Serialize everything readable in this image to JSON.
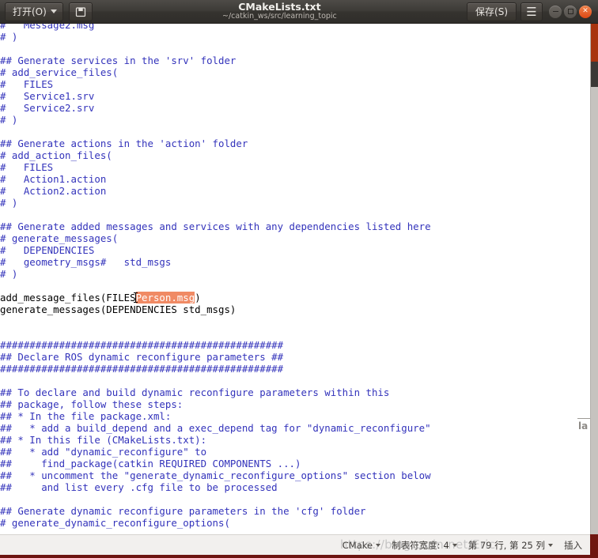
{
  "window": {
    "title": "CMakeLists.txt",
    "subtitle": "~/catkin_ws/src/learning_topic",
    "open_label": "打开(O)",
    "save_label": "保存(S)",
    "menu_icon": "hamburger-icon",
    "saveas_icon": "save-as-icon",
    "minimize_icon": "minimize-icon",
    "maximize_icon": "maximize-icon",
    "close_icon": "close-icon"
  },
  "editor": {
    "selection_text": "Person.msg",
    "selection_bg": "#f08a64",
    "comment_color": "#3333bb",
    "code_color": "#000000",
    "lines": [
      "#   Message2.msg",
      "# )",
      "",
      "## Generate services in the 'srv' folder",
      "# add_service_files(",
      "#   FILES",
      "#   Service1.srv",
      "#   Service2.srv",
      "# )",
      "",
      "## Generate actions in the 'action' folder",
      "# add_action_files(",
      "#   FILES",
      "#   Action1.action",
      "#   Action2.action",
      "# )",
      "",
      "## Generate added messages and services with any dependencies listed here",
      "# generate_messages(",
      "#   DEPENDENCIES",
      "#   geometry_msgs#   std_msgs",
      "# )",
      "",
      "__CODE_SELECTION_LINE__",
      "generate_messages(DEPENDENCIES std_msgs)",
      "",
      "",
      "################################################",
      "## Declare ROS dynamic reconfigure parameters ##",
      "################################################",
      "",
      "## To declare and build dynamic reconfigure parameters within this",
      "## package, follow these steps:",
      "## * In the file package.xml:",
      "##   * add a build_depend and a exec_depend tag for \"dynamic_reconfigure\"",
      "## * In this file (CMakeLists.txt):",
      "##   * add \"dynamic_reconfigure\" to",
      "##     find_package(catkin REQUIRED COMPONENTS ...)",
      "##   * uncomment the \"generate_dynamic_reconfigure_options\" section below",
      "##     and list every .cfg file to be processed",
      "",
      "## Generate dynamic reconfigure parameters in the 'cfg' folder",
      "# generate_dynamic_reconfigure_options("
    ],
    "selection_line": {
      "prefix": "add_message_files(FILES",
      "selected": "Person.msg",
      "suffix": ")"
    },
    "edge_ghost_text": "la"
  },
  "statusbar": {
    "language": "CMake",
    "tab_width_label": "制表符宽度:",
    "tab_width_value": "4",
    "position": "第 79 行, 第 25 列",
    "insert_mode": "插入"
  },
  "watermark": "https://blog.csdn.net/Eric"
}
